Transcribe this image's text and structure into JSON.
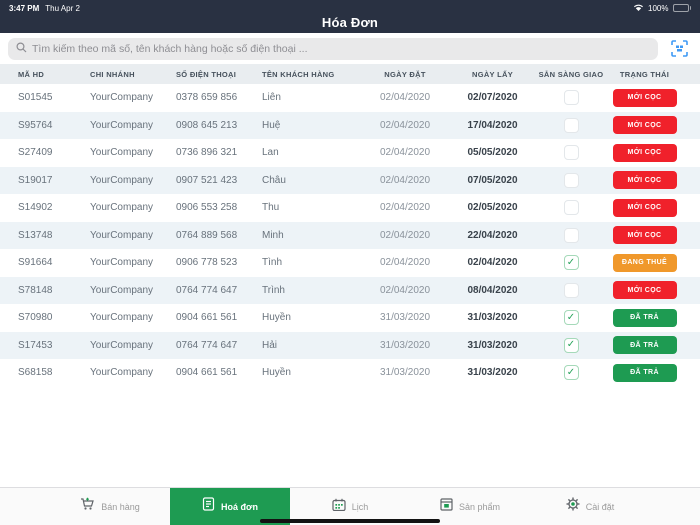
{
  "status_bar": {
    "time": "3:47 PM",
    "date": "Thu Apr 2",
    "battery": "100%"
  },
  "header": {
    "title": "Hóa Đơn"
  },
  "search": {
    "placeholder": "Tìm kiếm theo mã số, tên khách hàng hoặc số điện thoại ...",
    "scan_icon": "scan-icon",
    "search_icon": "search-icon"
  },
  "table": {
    "columns": [
      "MÃ HD",
      "CHI NHÁNH",
      "SỐ ĐIỆN THOẠI",
      "TÊN KHÁCH HÀNG",
      "NGÀY ĐẶT",
      "NGÀY LẤY",
      "SẴN SÀNG GIAO",
      "TRẠNG THÁI"
    ],
    "rows": [
      {
        "id": "S01545",
        "branch": "YourCompany",
        "phone": "0378 659 856",
        "customer": "Liên",
        "order_date": "02/04/2020",
        "pickup_date": "02/07/2020",
        "ready": false,
        "status": "MỚI CỌC",
        "status_type": "red"
      },
      {
        "id": "S95764",
        "branch": "YourCompany",
        "phone": "0908 645 213",
        "customer": "Huệ",
        "order_date": "02/04/2020",
        "pickup_date": "17/04/2020",
        "ready": false,
        "status": "MỚI CỌC",
        "status_type": "red"
      },
      {
        "id": "S27409",
        "branch": "YourCompany",
        "phone": "0736 896 321",
        "customer": "Lan",
        "order_date": "02/04/2020",
        "pickup_date": "05/05/2020",
        "ready": false,
        "status": "MỚI CỌC",
        "status_type": "red"
      },
      {
        "id": "S19017",
        "branch": "YourCompany",
        "phone": "0907 521 423",
        "customer": "Châu",
        "order_date": "02/04/2020",
        "pickup_date": "07/05/2020",
        "ready": false,
        "status": "MỚI CỌC",
        "status_type": "red"
      },
      {
        "id": "S14902",
        "branch": "YourCompany",
        "phone": "0906 553 258",
        "customer": "Thu",
        "order_date": "02/04/2020",
        "pickup_date": "02/05/2020",
        "ready": false,
        "status": "MỚI CỌC",
        "status_type": "red"
      },
      {
        "id": "S13748",
        "branch": "YourCompany",
        "phone": "0764 889 568",
        "customer": "Minh",
        "order_date": "02/04/2020",
        "pickup_date": "22/04/2020",
        "ready": false,
        "status": "MỚI CỌC",
        "status_type": "red"
      },
      {
        "id": "S91664",
        "branch": "YourCompany",
        "phone": "0906 778 523",
        "customer": "Tình",
        "order_date": "02/04/2020",
        "pickup_date": "02/04/2020",
        "ready": true,
        "status": "ĐANG THUÊ",
        "status_type": "orange"
      },
      {
        "id": "S78148",
        "branch": "YourCompany",
        "phone": "0764 774 647",
        "customer": "Trình",
        "order_date": "02/04/2020",
        "pickup_date": "08/04/2020",
        "ready": false,
        "status": "MỚI CỌC",
        "status_type": "red"
      },
      {
        "id": "S70980",
        "branch": "YourCompany",
        "phone": "0904 661 561",
        "customer": "Huyền",
        "order_date": "31/03/2020",
        "pickup_date": "31/03/2020",
        "ready": true,
        "status": "ĐÃ TRẢ",
        "status_type": "green"
      },
      {
        "id": "S17453",
        "branch": "YourCompany",
        "phone": "0764 774 647",
        "customer": "Hải",
        "order_date": "31/03/2020",
        "pickup_date": "31/03/2020",
        "ready": true,
        "status": "ĐÃ TRẢ",
        "status_type": "green"
      },
      {
        "id": "S68158",
        "branch": "YourCompany",
        "phone": "0904 661 561",
        "customer": "Huyền",
        "order_date": "31/03/2020",
        "pickup_date": "31/03/2020",
        "ready": true,
        "status": "ĐÃ TRẢ",
        "status_type": "green"
      }
    ]
  },
  "status_colors": {
    "red": "#f0212b",
    "orange": "#f0982b",
    "green": "#1e9b52"
  },
  "accent_colors": {
    "navy": "#293142",
    "tab_active_green": "#1e9b52",
    "scan_blue": "#3f9af5"
  },
  "tab_bar": {
    "items": [
      {
        "label": "Bán hàng",
        "icon": "cart-icon",
        "active": false
      },
      {
        "label": "Hoá đơn",
        "icon": "receipt-icon",
        "active": true
      },
      {
        "label": "Lịch",
        "icon": "calendar-icon",
        "active": false
      },
      {
        "label": "Sản phẩm",
        "icon": "box-icon",
        "active": false
      },
      {
        "label": "Cài đặt",
        "icon": "gear-icon",
        "active": false
      }
    ]
  }
}
